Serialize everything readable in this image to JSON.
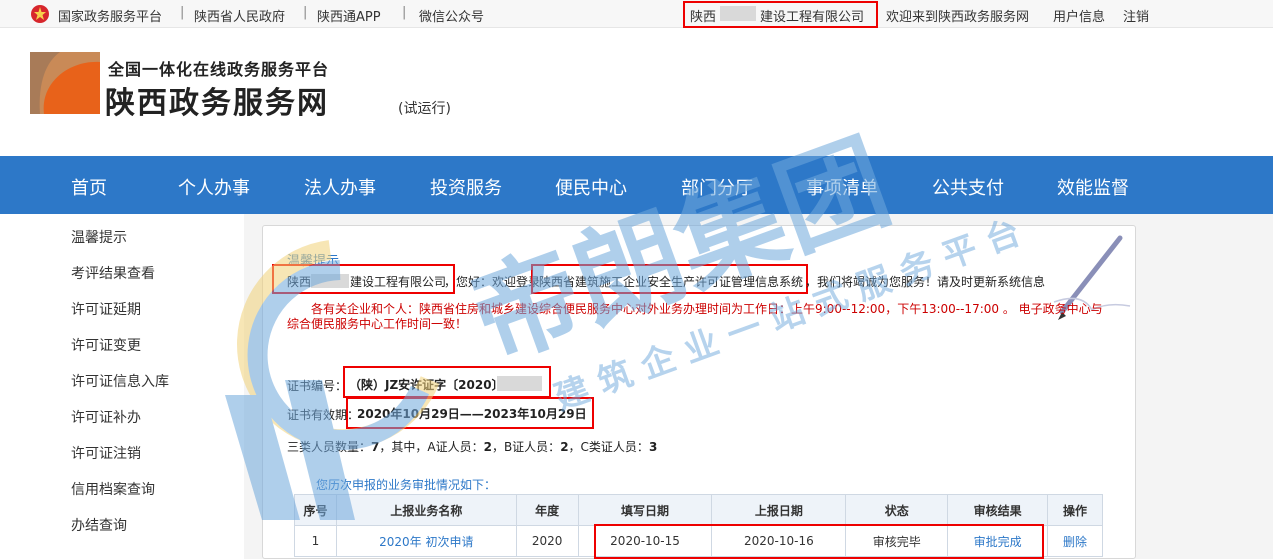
{
  "topbar": {
    "links": [
      "国家政务服务平台",
      "陕西省人民政府",
      "陕西通APP",
      "微信公众号"
    ],
    "separator": "|",
    "company_prefix": "陕西",
    "company_suffix": "建设工程有限公司",
    "welcome": "欢迎来到陕西政务服务网",
    "user_info": "用户信息",
    "logout": "注销"
  },
  "header": {
    "subtitle": "全国一体化在线政务服务平台",
    "title": "陕西政务服务网",
    "trial": "(试运行)"
  },
  "nav": [
    "首页",
    "个人办事",
    "法人办事",
    "投资服务",
    "便民中心",
    "部门分厅",
    "事项清单",
    "公共支付",
    "效能监督"
  ],
  "sidebar": [
    "温馨提示",
    "考评结果查看",
    "许可证延期",
    "许可证变更",
    "许可证信息入库",
    "许可证补办",
    "许可证注销",
    "信用档案查询",
    "办结查询"
  ],
  "content": {
    "tip_title": "温馨提示",
    "company_prefix": "陕西",
    "company_suffix": "建设工程有限公司",
    "greeting": "，您好：欢迎登录",
    "system_name": "陕西省建筑施工企业安全生产许可证管理信息系统",
    "service_note": "，我们将竭诚为您服务！请及时更新系统信息",
    "notice": "各有关企业和个人：陕西省住房和城乡建设综合便民服务中心对外业务办理时间为工作日：上午9:00--12:00，下午13:00--17:00 。 电子政务中心与综合便民服务中心工作时间一致！",
    "cert_no_label": "证书编号：",
    "cert_no": "（陕）JZ安许证字〔2020〕",
    "valid_label": "证书有效期：",
    "valid_range": "2020年10月29日——2023年10月29日",
    "staff_prefix": "三类人员数量：",
    "staff_total": "7",
    "staff_mid": "，其中，A证人员：",
    "staff_a": "2",
    "staff_b_label": "，B证人员：",
    "staff_b": "2",
    "staff_c_label": "，C类证人员：",
    "staff_c": "3",
    "history_title": "您历次申报的业务审批情况如下："
  },
  "table": {
    "headers": [
      "序号",
      "上报业务名称",
      "年度",
      "填写日期",
      "上报日期",
      "状态",
      "审核结果",
      "操作"
    ],
    "rows": [
      [
        "1",
        "2020年 初次申请",
        "2020",
        "2020-10-15",
        "2020-10-16",
        "审核完毕",
        "审批完成",
        "删除"
      ]
    ]
  },
  "watermark": {
    "main": "帝朗集团",
    "sub": "建 筑 企 业 一 站 式 服 务 平 台"
  },
  "colors": {
    "nav_blue": "#2d78c8",
    "highlight_red": "#ee0000",
    "notice_red": "#cc0000",
    "watermark_blue": "#6fa8dc"
  }
}
